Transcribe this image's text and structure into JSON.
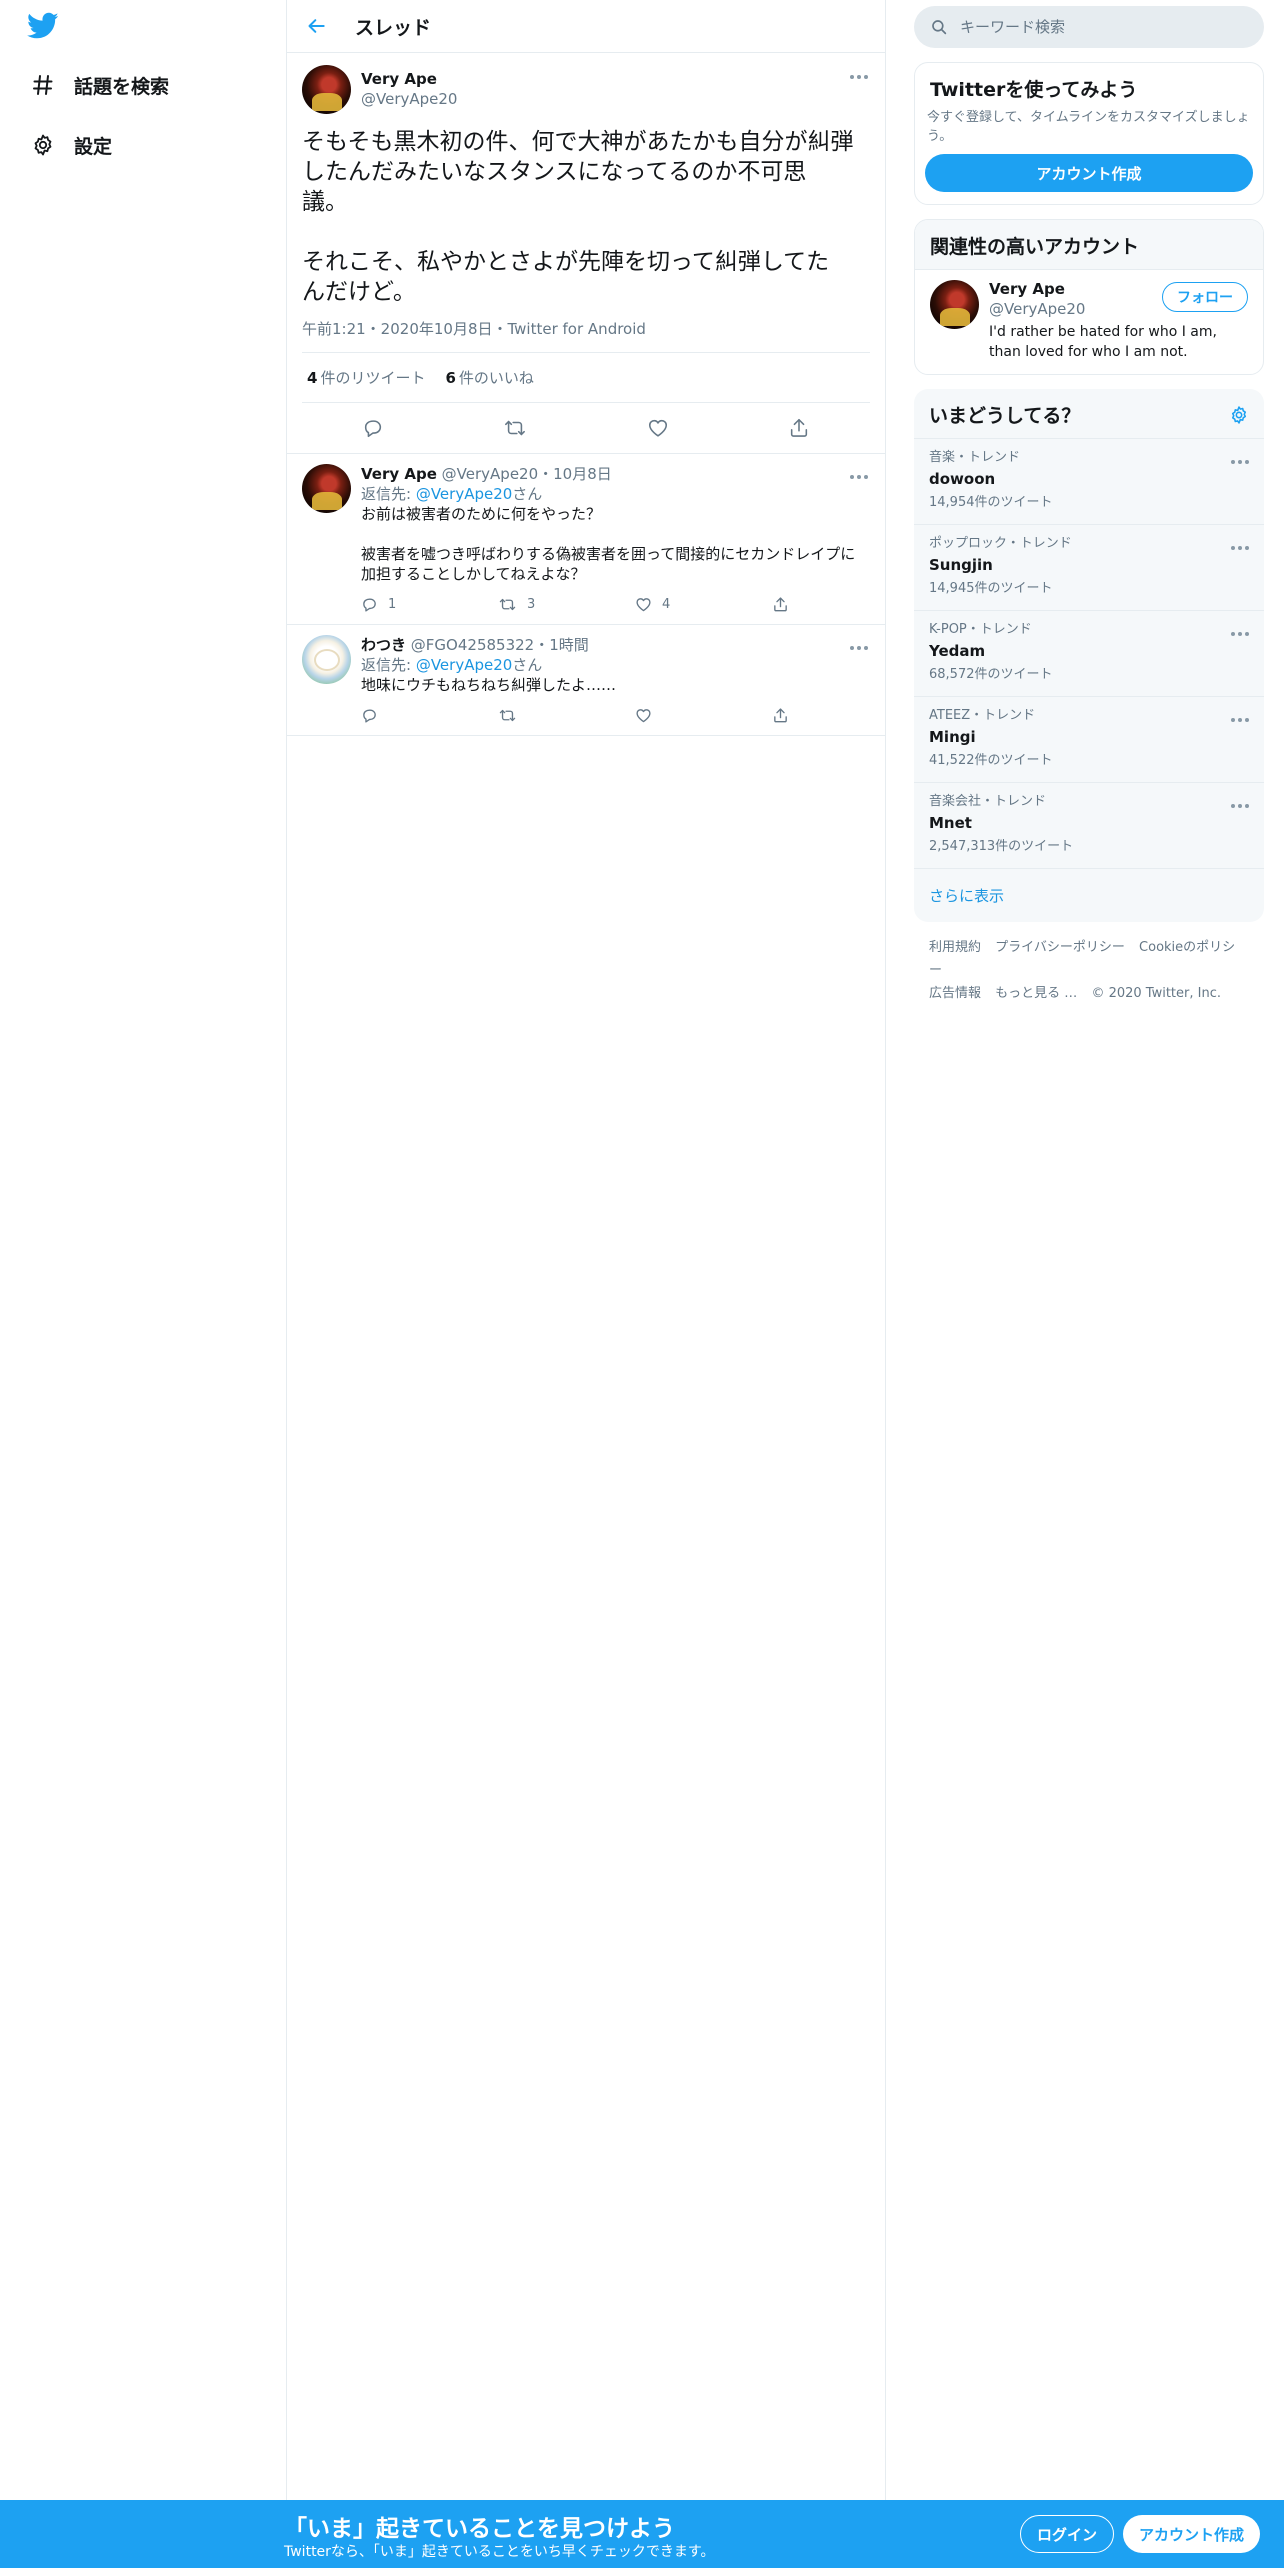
{
  "nav": {
    "logo_icon": "twitter-bird-icon",
    "items": [
      {
        "label": "話題を検索",
        "icon": "hashtag-icon"
      },
      {
        "label": "設定",
        "icon": "gear-icon"
      }
    ]
  },
  "header": {
    "title": "スレッド",
    "back_icon": "back-arrow-icon"
  },
  "focal_tweet": {
    "display_name": "Very Ape",
    "handle": "@VeryApe20",
    "text": "そもそも黒木初の件、何で大神があたかも自分が糾弾\nしたんだみたいなスタンスになってるのか不可思\n議。\n\nそれこそ、私やかとさよが先陣を切って糾弾してた\nんだけど。",
    "meta": "午前1:21・2020年10月8日・Twitter for Android",
    "retweet_count": "4",
    "retweet_label": "件のリツイート",
    "like_count": "6",
    "like_label": "件のいいね"
  },
  "replies": [
    {
      "display_name": "Very Ape",
      "meta": "@VeryApe20・10月8日",
      "reply_to_prefix": "返信先: ",
      "reply_to_mention": "@VeryApe20",
      "reply_to_suffix": "さん",
      "text": "お前は被害者のために何をやった？\n\n被害者を嘘つき呼ばわりする偽被害者を囲って間接的にセカンドレイプに\n加担することしかしてねえよな？",
      "reply_count": "1",
      "retweet_count": "3",
      "like_count": "4"
    },
    {
      "display_name": "わつき",
      "meta": "@FGO42585322・1時間",
      "reply_to_prefix": "返信先: ",
      "reply_to_mention": "@VeryApe20",
      "reply_to_suffix": "さん",
      "text": "地味にウチもねちねち糾弾したよ……",
      "reply_count": "",
      "retweet_count": "",
      "like_count": ""
    }
  ],
  "search": {
    "placeholder": "キーワード検索"
  },
  "signup_card": {
    "title": "Twitterを使ってみよう",
    "desc": "今すぐ登録して、タイムラインをカスタマイズしましょう。",
    "button": "アカウント作成"
  },
  "related": {
    "title": "関連性の高いアカウント",
    "display_name": "Very Ape",
    "handle": "@VeryApe20",
    "follow_label": "フォロー",
    "bio": "I'd rather be hated for who I am, than loved for who I am not."
  },
  "trends": {
    "title": "いまどうしてる？",
    "items": [
      {
        "category": "音楽・トレンド",
        "name": "dowoon",
        "count": "14,954件のツイート"
      },
      {
        "category": "ポップロック・トレンド",
        "name": "Sungjin",
        "count": "14,945件のツイート"
      },
      {
        "category": "K-POP・トレンド",
        "name": "Yedam",
        "count": "68,572件のツイート"
      },
      {
        "category": "ATEEZ・トレンド",
        "name": "Mingi",
        "count": "41,522件のツイート"
      },
      {
        "category": "音楽会社・トレンド",
        "name": "Mnet",
        "count": "2,547,313件のツイート"
      }
    ],
    "show_more": "さらに表示"
  },
  "footer": {
    "links": [
      "利用規約",
      "プライバシーポリシー",
      "Cookieのポリシー",
      "広告情報",
      "もっと見る …"
    ],
    "copyright": "© 2020 Twitter, Inc."
  },
  "bottom_bar": {
    "title": "「いま」起きていることを見つけよう",
    "subtitle": "Twitterなら、「いま」起きていることをいち早くチェックできます。",
    "login": "ログイン",
    "signup": "アカウント作成"
  },
  "colors": {
    "accent": "#1da1f2",
    "link": "#1b95e0",
    "muted": "#657786",
    "border": "#e6ecf0"
  }
}
